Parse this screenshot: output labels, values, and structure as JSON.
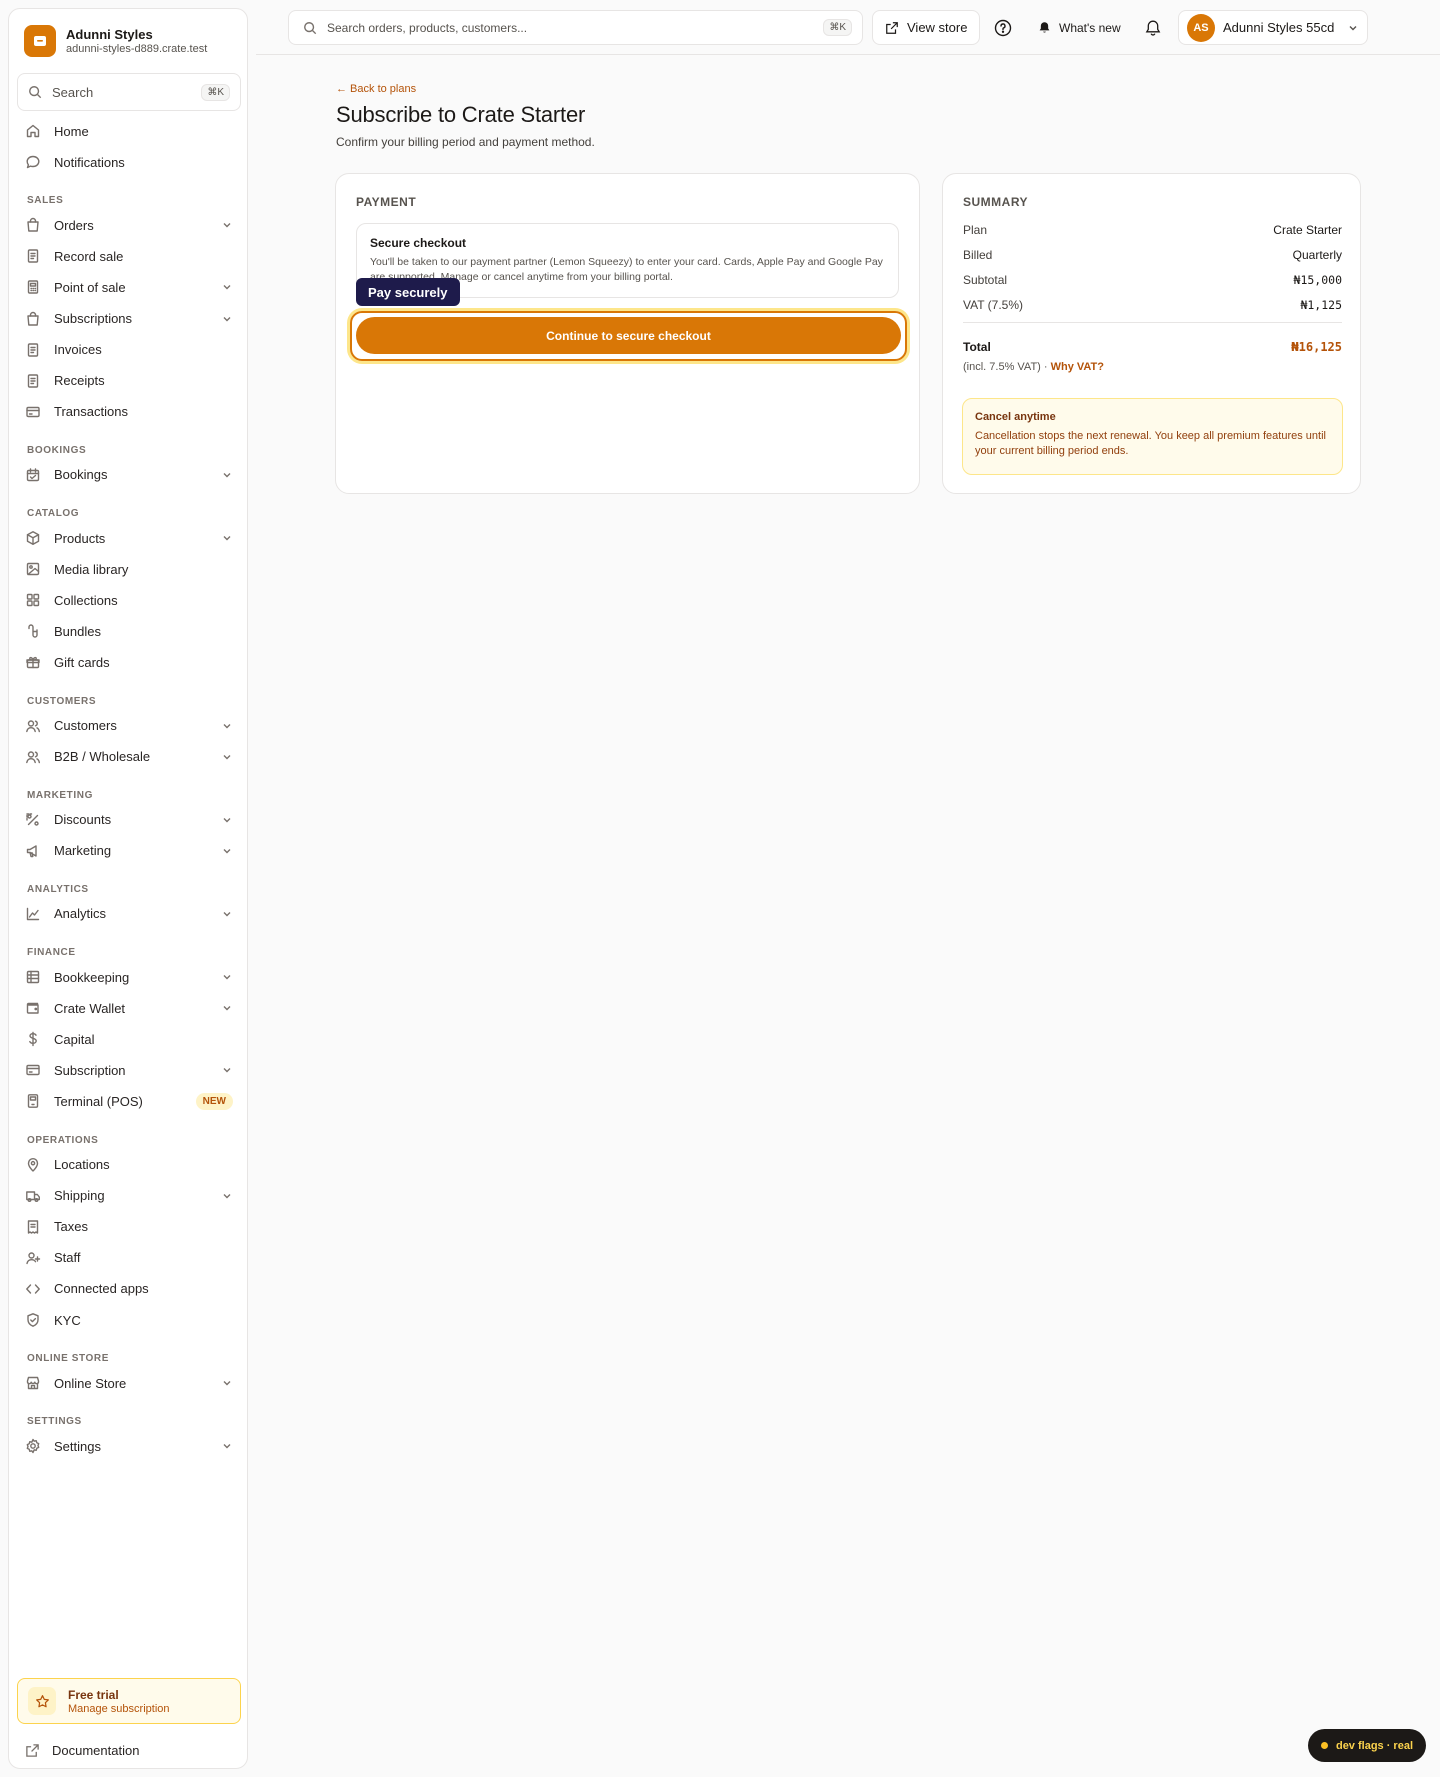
{
  "brand": {
    "name": "Adunni Styles",
    "domain": "adunni-styles-d889.crate.test"
  },
  "sidebar": {
    "search_label": "Search",
    "search_shortcut": "⌘K",
    "nav": [
      {
        "label": "Home"
      },
      {
        "label": "Notifications"
      },
      {
        "section": "SALES"
      },
      {
        "label": "Orders",
        "chevron": true
      },
      {
        "label": "Record sale"
      },
      {
        "label": "Point of sale",
        "chevron": true
      },
      {
        "label": "Subscriptions",
        "chevron": true
      },
      {
        "label": "Invoices"
      },
      {
        "label": "Receipts"
      },
      {
        "label": "Transactions"
      },
      {
        "section": "BOOKINGS"
      },
      {
        "label": "Bookings",
        "chevron": true
      },
      {
        "section": "CATALOG"
      },
      {
        "label": "Products",
        "chevron": true
      },
      {
        "label": "Media library"
      },
      {
        "label": "Collections"
      },
      {
        "label": "Bundles"
      },
      {
        "label": "Gift cards"
      },
      {
        "section": "CUSTOMERS"
      },
      {
        "label": "Customers",
        "chevron": true
      },
      {
        "label": "B2B / Wholesale",
        "chevron": true
      },
      {
        "section": "MARKETING"
      },
      {
        "label": "Discounts",
        "chevron": true
      },
      {
        "label": "Marketing",
        "chevron": true
      },
      {
        "section": "ANALYTICS"
      },
      {
        "label": "Analytics",
        "chevron": true
      },
      {
        "section": "FINANCE"
      },
      {
        "label": "Bookkeeping",
        "chevron": true
      },
      {
        "label": "Crate Wallet",
        "chevron": true
      },
      {
        "label": "Capital"
      },
      {
        "label": "Subscription",
        "chevron": true
      },
      {
        "label": "Terminal (POS)",
        "badge": "NEW"
      },
      {
        "section": "OPERATIONS"
      },
      {
        "label": "Locations"
      },
      {
        "label": "Shipping",
        "chevron": true
      },
      {
        "label": "Taxes"
      },
      {
        "label": "Staff"
      },
      {
        "label": "Connected apps"
      },
      {
        "label": "KYC"
      },
      {
        "section": "ONLINE STORE"
      },
      {
        "label": "Online Store",
        "chevron": true
      },
      {
        "section": "SETTINGS"
      },
      {
        "label": "Settings",
        "chevron": true
      }
    ],
    "trial": {
      "title": "Free trial",
      "subtitle": "Manage subscription"
    },
    "docs_label": "Documentation"
  },
  "topbar": {
    "search_placeholder": "Search orders, products, customers...",
    "search_shortcut": "⌘K",
    "view_store": "View store",
    "whats_new": "What's new",
    "account_initials": "AS",
    "account_name": "Adunni Styles 55cd"
  },
  "page": {
    "back_link": "← Back to plans",
    "title": "Subscribe to Crate Starter",
    "subtitle": "Confirm your billing period and payment method."
  },
  "payment": {
    "heading": "PAYMENT",
    "secure_title": "Secure checkout",
    "secure_desc": "You'll be taken to our payment partner (Lemon Squeezy) to enter your card. Cards, Apple Pay and Google Pay are supported. Manage or cancel anytime from your billing portal.",
    "tooltip": "Pay securely",
    "cta": "Continue to secure checkout"
  },
  "summary": {
    "heading": "SUMMARY",
    "rows": [
      {
        "k": "Plan",
        "v": "Crate Starter"
      },
      {
        "k": "Billed",
        "v": "Quarterly"
      },
      {
        "k": "Subtotal",
        "v": "₦15,000"
      },
      {
        "k": "VAT (7.5%)",
        "v": "₦1,125"
      }
    ],
    "total_label": "Total",
    "total_value": "₦16,125",
    "incl_note": "(incl. 7.5% VAT) ·",
    "why_vat": "Why VAT?",
    "cancel_title": "Cancel anytime",
    "cancel_desc": "Cancellation stops the next renewal. You keep all premium features until your current billing period ends."
  },
  "devflags": "dev flags · real",
  "colors": {
    "accent": "#d97706",
    "accent_dark": "#b45309",
    "tooltip_bg": "#1e1b4b"
  }
}
